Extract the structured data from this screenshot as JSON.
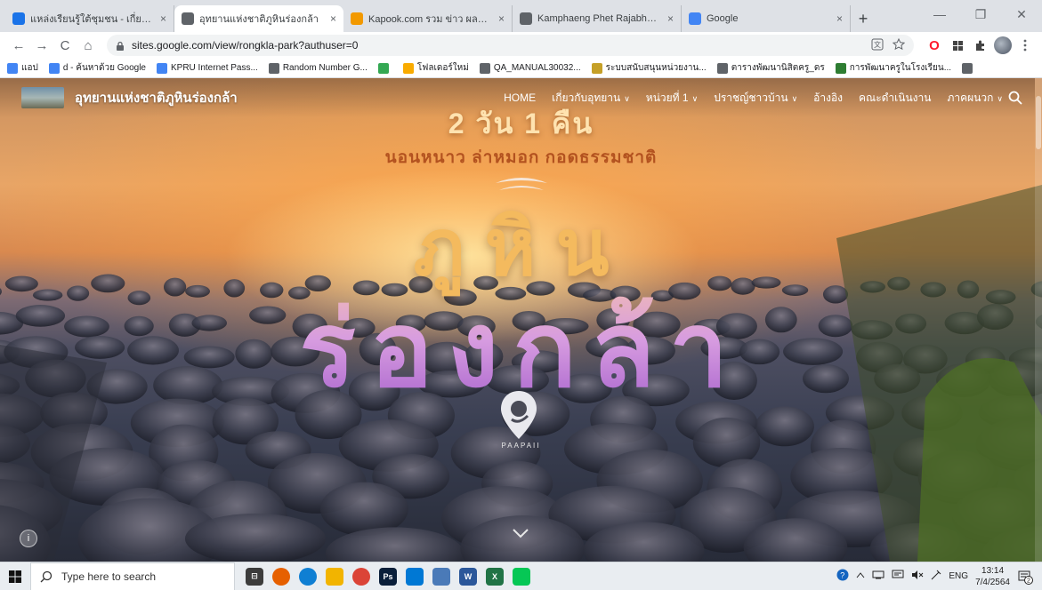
{
  "browser": {
    "tabs": [
      {
        "title": "แหล่งเรียนรู้ใต้ชุมชน - เกี่ยวกับโครงการ",
        "favicon_color": "#1a73e8",
        "active": false
      },
      {
        "title": "อุทยานแห่งชาติภูหินร่องกล้า",
        "favicon_color": "#5f6368",
        "active": true
      },
      {
        "title": "Kapook.com รวม ข่าว ผลบอล ดารา",
        "favicon_color": "#f29900",
        "active": false
      },
      {
        "title": "Kamphaeng Phet Rajabhat Unive",
        "favicon_color": "#5f6368",
        "active": false
      },
      {
        "title": "Google",
        "favicon_color": "#4285f4",
        "active": false
      }
    ],
    "new_tab_symbol": "+",
    "close_symbol": "×",
    "window_controls": [
      "—",
      "❐",
      "✕"
    ],
    "nav": {
      "back": "←",
      "forward": "→",
      "reload": "C",
      "home": "⌂"
    },
    "url": "sites.google.com/view/rongkla-park?authuser=0",
    "bookmarks": [
      {
        "label": "แอป",
        "color": "#4285f4"
      },
      {
        "label": "d - ค้นหาด้วย Google",
        "color": "#4285f4"
      },
      {
        "label": "KPRU Internet Pass...",
        "color": "#4285f4"
      },
      {
        "label": "Random Number G...",
        "color": "#5f6368"
      },
      {
        "label": "",
        "color": "#34a853"
      },
      {
        "label": "โฟลเดอร์ใหม่",
        "color": "#f9ab00"
      },
      {
        "label": "QA_MANUAL30032...",
        "color": "#5f6368"
      },
      {
        "label": "ระบบสนับสนุนหน่วยงาน...",
        "color": "#c5a028"
      },
      {
        "label": "ตารางพัฒนานิสิตครู_ดร",
        "color": "#5f6368"
      },
      {
        "label": "การพัฒนาครูในโรงเรียน...",
        "color": "#2e7d32"
      },
      {
        "label": "",
        "color": "#5f6368"
      }
    ]
  },
  "site": {
    "name": "อุทยานแห่งชาติภูหินร่องกล้า",
    "menu": [
      {
        "label": "HOME",
        "has_dropdown": false
      },
      {
        "label": "เกี่ยวกับอุทยาน",
        "has_dropdown": true
      },
      {
        "label": "หน่วยที่ 1",
        "has_dropdown": true
      },
      {
        "label": "ปราชญ์ชาวบ้าน",
        "has_dropdown": true
      },
      {
        "label": "อ้างอิง",
        "has_dropdown": false
      },
      {
        "label": "คณะดำเนินงาน",
        "has_dropdown": false
      },
      {
        "label": "ภาคผนวก",
        "has_dropdown": true
      }
    ],
    "dropdown_symbol": "∨",
    "hero": {
      "subtitle1": "2 วัน 1 คืน",
      "subtitle2": "นอนหนาว ล่าหมอก กอดธรรมชาติ",
      "title_line1": "ภูหิน",
      "title_line2": "ร่องกล้า",
      "brand": "PAAPAII"
    },
    "info_symbol": "i"
  },
  "taskbar": {
    "search_placeholder": "Type here to search",
    "apps": [
      {
        "name": "task-view",
        "color": "#3c3c3c",
        "glyph": "⊟"
      },
      {
        "name": "firefox",
        "color": "#e66000",
        "glyph": ""
      },
      {
        "name": "edge",
        "color": "#0f7fd3",
        "glyph": ""
      },
      {
        "name": "files",
        "color": "#f2b400",
        "glyph": ""
      },
      {
        "name": "chrome",
        "color": "#db4437",
        "glyph": ""
      },
      {
        "name": "photoshop",
        "color": "#0a1f3a",
        "glyph": "Ps"
      },
      {
        "name": "mail",
        "color": "#0078d4",
        "glyph": ""
      },
      {
        "name": "app",
        "color": "#4a7ab8",
        "glyph": ""
      },
      {
        "name": "word",
        "color": "#2b579a",
        "glyph": "W"
      },
      {
        "name": "excel",
        "color": "#217346",
        "glyph": "X"
      },
      {
        "name": "line",
        "color": "#06c755",
        "glyph": ""
      }
    ],
    "lang": "ENG",
    "time": "13:14",
    "date": "7/4/2564",
    "notifications": "2"
  }
}
